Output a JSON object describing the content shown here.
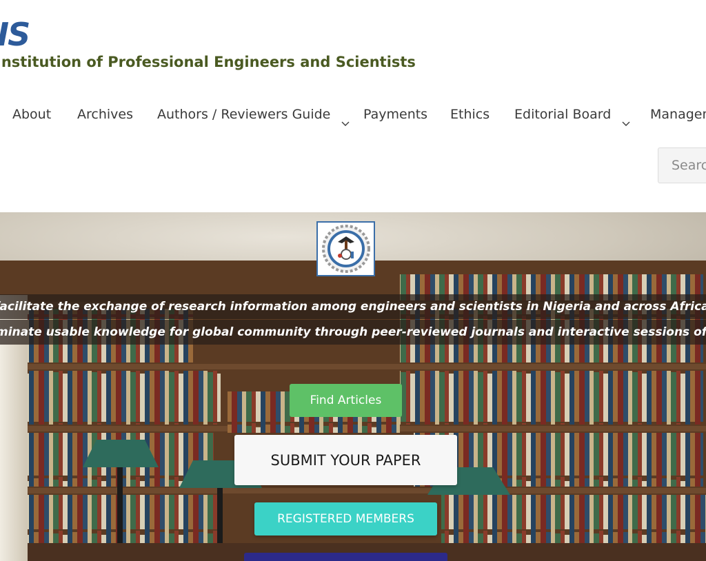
{
  "header": {
    "logo_abbr": "IS",
    "logo_name": "Institution of Professional Engineers and Scientists"
  },
  "nav": {
    "items": [
      {
        "label": "About"
      },
      {
        "label": "Archives"
      },
      {
        "label": "Authors / Reviewers Guide",
        "dropdown": true
      },
      {
        "label": "Payments"
      },
      {
        "label": "Ethics"
      },
      {
        "label": "Editorial Board",
        "dropdown": true
      },
      {
        "label": "Managem"
      }
    ]
  },
  "search": {
    "placeholder": "Search"
  },
  "hero": {
    "mission_line_1": "facilitate the exchange of research information among engineers and scientists in Nigeria and across Africa by providing",
    "mission_line_2": "minate usable knowledge for global community through peer-reviewed journals and interactive sessions of members and g",
    "buttons": {
      "find_articles": "Find Articles",
      "submit_paper": "SUBMIT YOUR PAPER",
      "registered_members": "REGISTERED MEMBERS"
    }
  },
  "colors": {
    "nav_text": "#3a3a3a",
    "find_articles_bg": "#5ec167",
    "registered_members_bg": "#3bd2c6",
    "next_button_bg": "#2c2a8a",
    "logo_blue": "#2d5b9a",
    "logo_olive": "#4a5a22"
  },
  "icons": {
    "dropdown": "chevron-down-icon",
    "emblem": "institution-emblem-icon"
  }
}
